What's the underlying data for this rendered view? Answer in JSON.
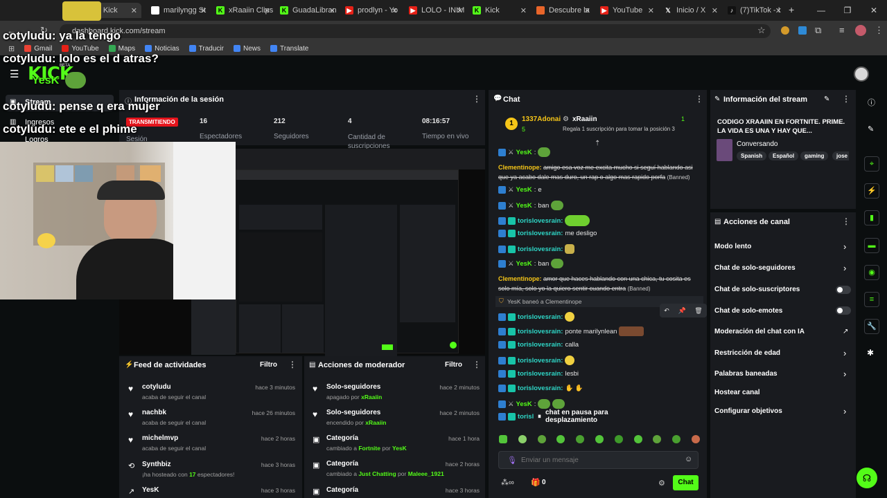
{
  "browser": {
    "tabs": [
      {
        "label": "ream - Kick",
        "color": "#53fc18",
        "active": true
      },
      {
        "label": "marilyngg St",
        "color": "#ffffff"
      },
      {
        "label": "xRaaiin Clips",
        "color": "#53fc18"
      },
      {
        "label": "GuadaLibran",
        "color": "#53fc18"
      },
      {
        "label": "prodlyn - Yo",
        "color": "#e62117"
      },
      {
        "label": "LOLO - INIM",
        "color": "#e62117"
      },
      {
        "label": "Kick",
        "color": "#53fc18"
      },
      {
        "label": "Descubre la",
        "color": "#e8652a"
      },
      {
        "label": "YouTube",
        "color": "#e62117"
      },
      {
        "label": "Inicio / X",
        "color": "#ffffff"
      },
      {
        "label": "(7)TikTok - I",
        "color": "#ff2d55"
      }
    ],
    "url": "dashboard.kick.com/stream",
    "bookmarks": [
      "Gmail",
      "YouTube",
      "Maps",
      "Noticias",
      "Traducir",
      "News",
      "Translate"
    ]
  },
  "overlay_chat": [
    {
      "user": "cotyludu:",
      "text": "ya la tengo"
    },
    {
      "user": "cotyludu:",
      "text": "lolo es el d atras?"
    },
    {
      "user": "cotyludu:",
      "text": "pense q era mujer"
    },
    {
      "user": "cotyludu:",
      "text": "ete e el phime"
    }
  ],
  "nav": {
    "logo": "KICK",
    "logo_beta": "BETA",
    "items": [
      "Stream",
      "Ingresos",
      "Logros"
    ],
    "overlay_name": "YesK"
  },
  "session": {
    "title": "Información de la sesión",
    "live_badge": "TRANSMITIENDO",
    "session_label": "Sesión",
    "stats": [
      {
        "value": "16",
        "label": "Espectadores"
      },
      {
        "value": "212",
        "label": "Seguidores"
      },
      {
        "value": "4",
        "label": "Cantidad de suscripciones"
      },
      {
        "value": "08:16:57",
        "label": "Tiempo en vivo"
      }
    ]
  },
  "chat": {
    "title": "Chat",
    "pinned": {
      "rank": "1",
      "user": "1337Adonai",
      "count": "5",
      "channel": "xRaaiin",
      "sub_count": "1",
      "promo": "Regala 1 suscripción para tomar la posición 3"
    },
    "messages": [
      {
        "user": "YesK",
        "text": "",
        "style": "mod"
      },
      {
        "user": "Clementinope:",
        "text": "amigo esa voz me excita mucho si seguí hablando asi que ya acabo dale mas duro, un rap o algo mas rapido porfa",
        "banned": "(Banned)"
      },
      {
        "user": "YesK",
        "text": "e",
        "style": "mod"
      },
      {
        "user": "YesK",
        "text": "ban",
        "style": "mod"
      },
      {
        "user": "torislovesrain:",
        "text": ""
      },
      {
        "user": "torislovesrain:",
        "text": "me desligo"
      },
      {
        "user": "torislovesrain:",
        "text": ""
      },
      {
        "user": "YesK",
        "text": "ban",
        "style": "mod"
      },
      {
        "user": "Clementinope:",
        "text": "amor que haces hablando con una chica, tu cosita es solo mía, solo yo la quiero sentir cuando entra",
        "banned": "(Banned)"
      },
      {
        "system": "YesK baneó a Clementinope"
      },
      {
        "user": "torislovesrain:",
        "text": ""
      },
      {
        "user": "torislovesrain:",
        "text": "ponte marilynlean"
      },
      {
        "user": "torislovesrain:",
        "text": "calla"
      },
      {
        "user": "torislovesrain:",
        "text": ""
      },
      {
        "user": "torislovesrain:",
        "text": "lesbi"
      },
      {
        "user": "torislovesrain:",
        "text": ""
      },
      {
        "user": "YesK",
        "text": "",
        "style": "mod"
      },
      {
        "user": "torisl",
        "text": ""
      }
    ],
    "paused": "chat en pausa para desplazamiento",
    "input_placeholder": "Enviar un mensaje",
    "points": "0",
    "send_label": "Chat"
  },
  "stream_info": {
    "title": "Información del stream",
    "stream_title": "CODIGO XRAAIIN EN FORTNITE. PRIME. LA VIDA ES UNA Y HAY QUE...",
    "category": "Conversando",
    "tags": [
      "Spanish",
      "Español",
      "gaming",
      "jose"
    ]
  },
  "channel_actions": {
    "title": "Acciones de canal",
    "items": [
      {
        "label": "Modo lento",
        "kind": "chevron"
      },
      {
        "label": "Chat de solo-seguidores",
        "kind": "chevron"
      },
      {
        "label": "Chat de solo-suscriptores",
        "kind": "toggle"
      },
      {
        "label": "Chat de solo-emotes",
        "kind": "toggle"
      },
      {
        "label": "Moderación del chat con IA",
        "kind": "external"
      },
      {
        "label": "Restricción de edad",
        "kind": "chevron"
      },
      {
        "label": "Palabras baneadas",
        "kind": "chevron"
      },
      {
        "label": "Hostear canal",
        "kind": "none"
      },
      {
        "label": "Configurar objetivos",
        "kind": "chevron"
      }
    ]
  },
  "activity_feed": {
    "title": "Feed de actividades",
    "filter": "Filtro",
    "items": [
      {
        "name": "cotyludu",
        "sub": "acaba de seguir el canal",
        "time": "hace 3 minutos"
      },
      {
        "name": "nachbk",
        "sub": "acaba de seguir el canal",
        "time": "hace 26 minutos"
      },
      {
        "name": "michelmvp",
        "sub": "acaba de seguir el canal",
        "time": "hace 2 horas"
      },
      {
        "name": "Synthbiz",
        "sub_pre": "¡ha hosteado con",
        "sub_num": "17",
        "sub_post": "espectadores!",
        "time": "hace 3 horas"
      },
      {
        "name": "YesK",
        "sub": "",
        "time": "hace 3 horas"
      }
    ]
  },
  "mod_actions": {
    "title": "Acciones de moderador",
    "filter": "Filtro",
    "items": [
      {
        "name": "Solo-seguidores",
        "pre": "apagado por",
        "by": "xRaaiin",
        "time": "hace 2 minutos"
      },
      {
        "name": "Solo-seguidores",
        "pre": "encendido por",
        "by": "xRaaiin",
        "time": "hace 2 minutos"
      },
      {
        "name": "Categoría",
        "pre": "cambiado a",
        "what": "Fortnite",
        "mid": "por",
        "by": "YesK",
        "time": "hace 1 hora"
      },
      {
        "name": "Categoría",
        "pre": "cambiado a",
        "what": "Just Chatting",
        "mid": "por",
        "by": "Maleee_1921",
        "time": "hace 2 horas"
      },
      {
        "name": "Categoría",
        "pre": "",
        "time": "hace 3 horas"
      }
    ]
  }
}
